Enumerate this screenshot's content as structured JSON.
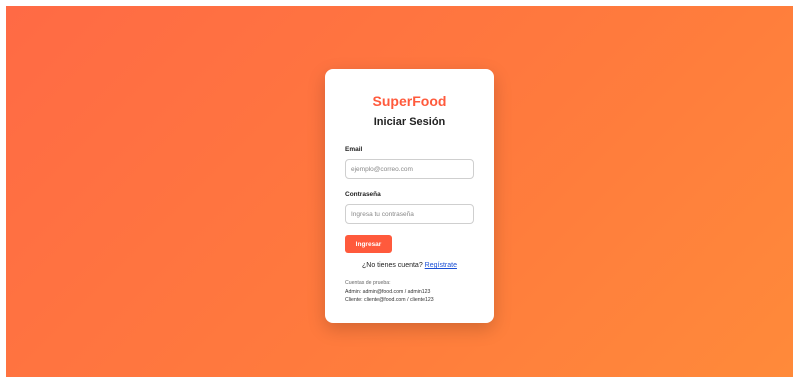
{
  "brand": "SuperFood",
  "title": "Iniciar Sesión",
  "email": {
    "label": "Email",
    "placeholder": "ejemplo@correo.com",
    "value": ""
  },
  "password": {
    "label": "Contraseña",
    "placeholder": "Ingresa tu contraseña",
    "value": ""
  },
  "submit_label": "Ingresar",
  "register": {
    "prompt": "¿No tienes cuenta?",
    "link_label": "Regístrate"
  },
  "test_accounts": {
    "heading": "Cuentas de prueba:",
    "admin": "Admin: admin@food.com / admin123",
    "client": "Cliente: cliente@food.com / cliente123"
  },
  "colors": {
    "accent": "#ff5a3c",
    "link": "#1a4fd6",
    "background_start": "#ff6a45",
    "background_end": "#ff8a3a"
  }
}
